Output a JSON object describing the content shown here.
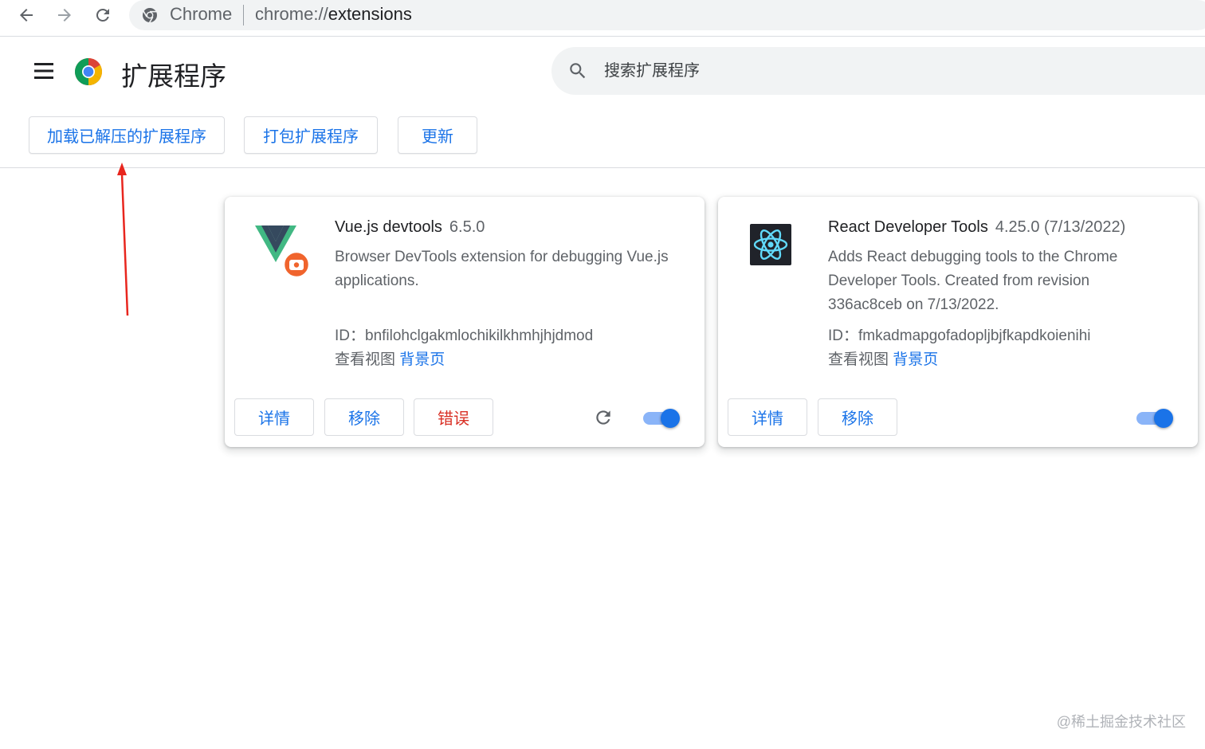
{
  "browser": {
    "site_label": "Chrome",
    "url_scheme": "chrome://",
    "url_host": "extensions"
  },
  "header": {
    "title": "扩展程序",
    "search_placeholder": "搜索扩展程序"
  },
  "dev_buttons": {
    "load_unpacked": "加载已解压的扩展程序",
    "pack": "打包扩展程序",
    "update": "更新"
  },
  "extensions": [
    {
      "name": "Vue.js devtools",
      "version": "6.5.0",
      "description": "Browser DevTools extension for debugging Vue.js applications.",
      "id_line": "ID：bnfilohclgakmlochikilkhmhjhjdmod",
      "views_label": "查看视图",
      "views_link": "背景页",
      "buttons": {
        "details": "详情",
        "remove": "移除",
        "errors": "错误"
      },
      "enabled": true,
      "icon": "vue-devtools-icon"
    },
    {
      "name": "React Developer Tools",
      "version": "4.25.0 (7/13/2022)",
      "description": "Adds React debugging tools to the Chrome Developer Tools. Created from revision 336ac8ceb on 7/13/2022.",
      "id_line": "ID：fmkadmapgofadopljbjfkapdkoienihi",
      "views_label": "查看视图",
      "views_link": "背景页",
      "buttons": {
        "details": "详情",
        "remove": "移除"
      },
      "enabled": true,
      "icon": "react-devtools-icon"
    }
  ],
  "watermark": "@稀土掘金技术社区",
  "colors": {
    "accent": "#1a73e8",
    "error": "#d93025",
    "annotation_arrow": "#e8261e"
  }
}
